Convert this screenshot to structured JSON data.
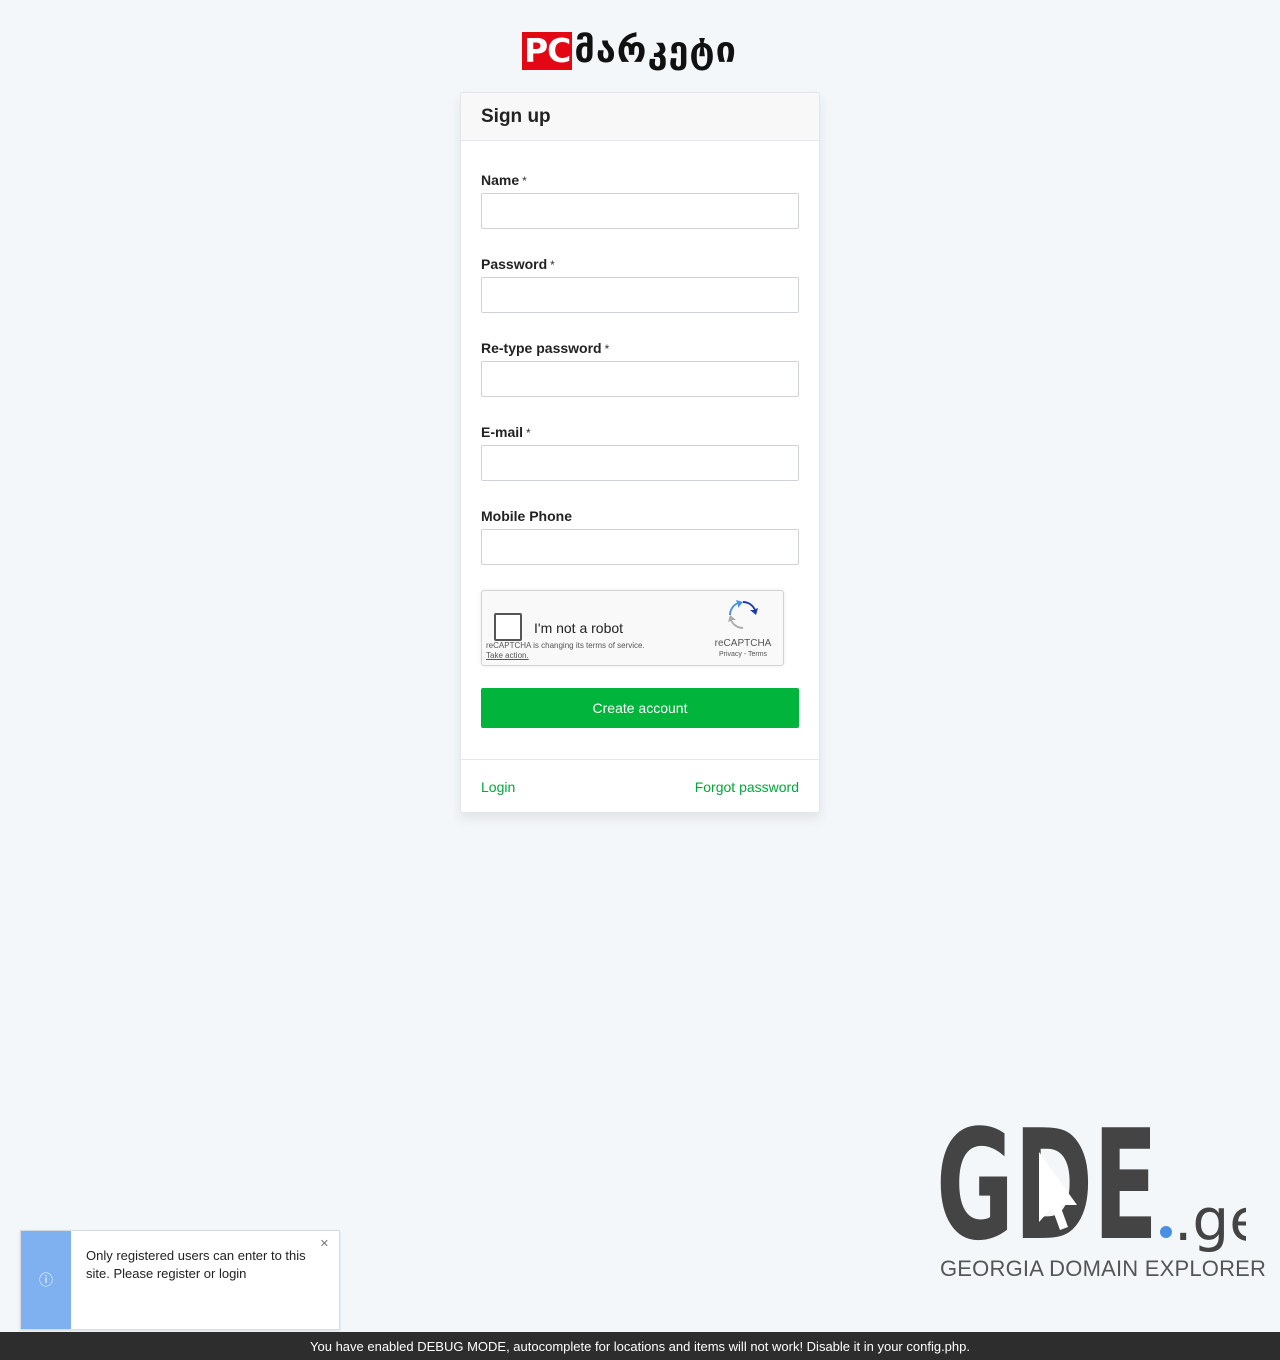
{
  "logo": {
    "pc": "PC",
    "text": "მარკეტი"
  },
  "signup": {
    "title": "Sign up",
    "required_mark": "*",
    "fields": {
      "name": {
        "label": "Name",
        "value": ""
      },
      "password": {
        "label": "Password",
        "value": ""
      },
      "retype": {
        "label": "Re-type password",
        "value": ""
      },
      "email": {
        "label": "E-mail",
        "value": ""
      },
      "phone": {
        "label": "Mobile Phone",
        "value": ""
      }
    },
    "captcha": {
      "label": "I'm not a robot",
      "note": "reCAPTCHA is changing its terms of service.",
      "action": "Take action.",
      "brand": "reCAPTCHA",
      "links": "Privacy - Terms"
    },
    "create_button": "Create account",
    "login_link": "Login",
    "forgot_link": "Forgot password"
  },
  "gde": {
    "main": "GDE",
    "suffix": ".ge",
    "subtitle": "GEORGIA DOMAIN EXPLORER"
  },
  "toast": {
    "icon": "info-icon",
    "message": "Only registered users can enter to this site. Please register or login",
    "close_icon": "close-icon"
  },
  "debug": "You have enabled DEBUG MODE, autocomplete for locations and items will not work! Disable it in your config.php.",
  "colors": {
    "accent": "#00b43c",
    "link": "#00a83a",
    "logo_red": "#e30613",
    "toast_side": "#7fb0ef",
    "debug_bg": "#2d2d2d"
  }
}
